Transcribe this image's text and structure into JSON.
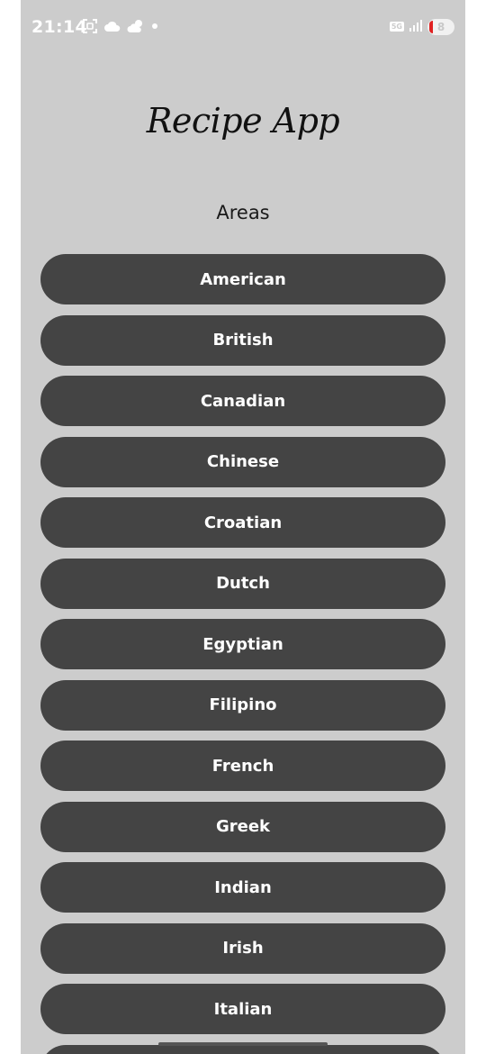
{
  "status_bar": {
    "time": "21:14",
    "network": "5G",
    "battery": "8",
    "icons_left": [
      "screenshot-icon",
      "cloud-icon",
      "partly-cloudy-icon",
      "notification-dot-icon"
    ],
    "icons_right": [
      "network-5g-icon",
      "signal-icon",
      "battery-icon"
    ]
  },
  "header": {
    "title": "Recipe App"
  },
  "section": {
    "heading": "Areas"
  },
  "areas": [
    "American",
    "British",
    "Canadian",
    "Chinese",
    "Croatian",
    "Dutch",
    "Egyptian",
    "Filipino",
    "French",
    "Greek",
    "Indian",
    "Irish",
    "Italian",
    ""
  ],
  "colors": {
    "background": "#cccccc",
    "button": "#444444",
    "button_text": "#ffffff",
    "battery_low": "#e02020"
  }
}
